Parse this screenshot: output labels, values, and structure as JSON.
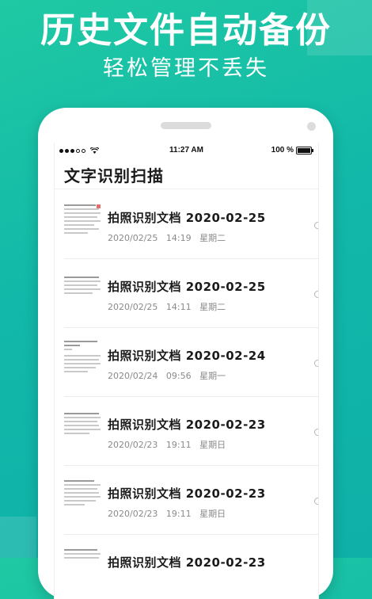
{
  "promo": {
    "headline": "历史文件自动备份",
    "subhead": "轻松管理不丢失"
  },
  "status_bar": {
    "time": "11:27 AM",
    "battery": "100 %",
    "wifi_icon": "wifi-icon",
    "signal_icon": "signal-dots-icon"
  },
  "page": {
    "title": "文字识别扫描"
  },
  "documents": [
    {
      "title": "拍照识别文档   2020-02-25",
      "date": "2020/02/25",
      "time": "14:19",
      "weekday": "星期二"
    },
    {
      "title": "拍照识别文档   2020-02-25",
      "date": "2020/02/25",
      "time": "14:11",
      "weekday": "星期二"
    },
    {
      "title": "拍照识别文档   2020-02-24",
      "date": "2020/02/24",
      "time": "09:56",
      "weekday": "星期一"
    },
    {
      "title": "拍照识别文档   2020-02-23",
      "date": "2020/02/23",
      "time": "19:11",
      "weekday": "星期日"
    },
    {
      "title": "拍照识别文档   2020-02-23",
      "date": "2020/02/23",
      "time": "19:11",
      "weekday": "星期日"
    },
    {
      "title": "拍照识别文档   2020-02-23",
      "date": "",
      "time": "",
      "weekday": ""
    }
  ],
  "colors": {
    "background_start": "#1fc9a3",
    "background_end": "#0fb0a8",
    "meta_text": "#8a8a8a",
    "title_text": "#1a1a1a"
  }
}
